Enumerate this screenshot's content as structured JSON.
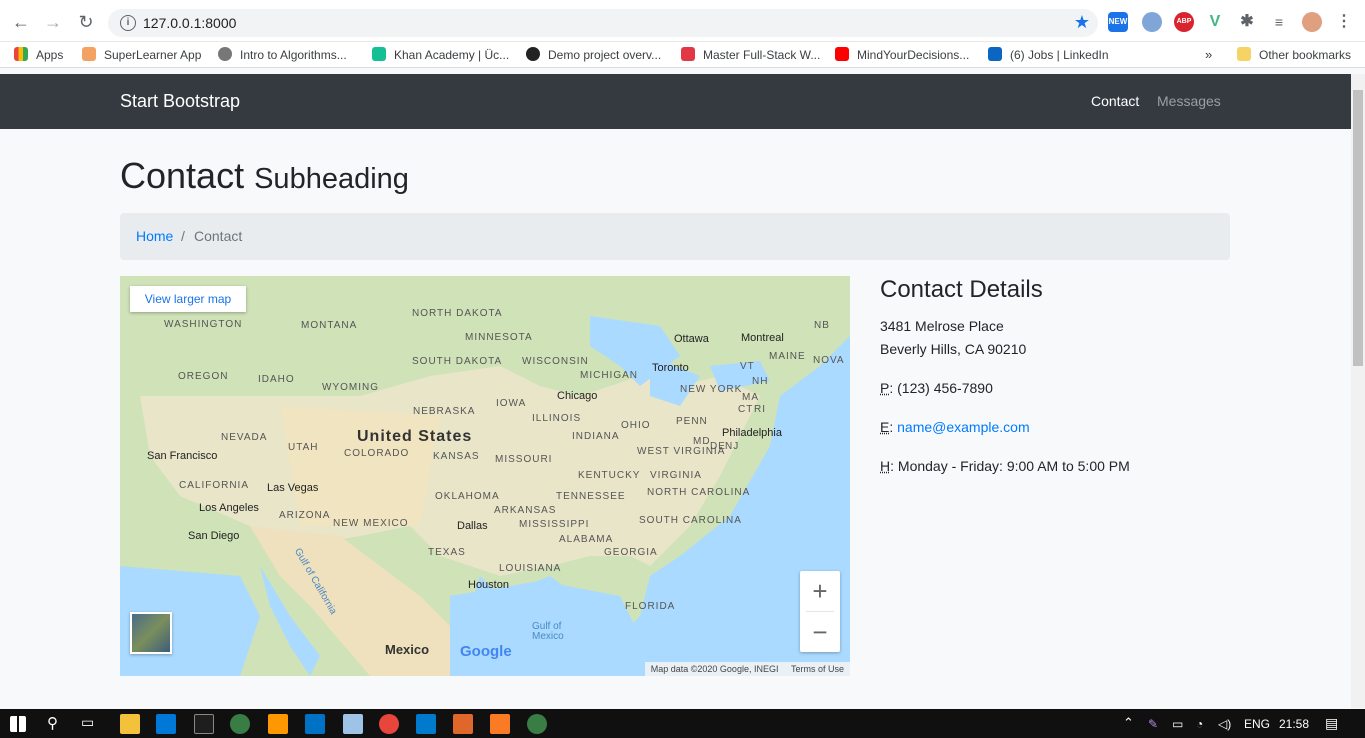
{
  "browser": {
    "url": "127.0.0.1:8000",
    "bookmarks": [
      {
        "label": "Apps",
        "color": "#e8453c"
      },
      {
        "label": "SuperLearner App",
        "color": "#f4a261"
      },
      {
        "label": "Intro to Algorithms...",
        "color": "#666666"
      },
      {
        "label": "Khan Academy | Üc...",
        "color": "#14bf96"
      },
      {
        "label": "Demo project overv...",
        "color": "#222222"
      },
      {
        "label": "Master Full-Stack W...",
        "color": "#e23744"
      },
      {
        "label": "MindYourDecisions...",
        "color": "#ff0000"
      },
      {
        "label": "(6) Jobs | LinkedIn",
        "color": "#0a66c2"
      }
    ],
    "bookmarks_overflow": "»",
    "other_bookmarks": "Other bookmarks"
  },
  "site": {
    "brand": "Start Bootstrap",
    "nav": [
      {
        "label": "Contact",
        "active": true
      },
      {
        "label": "Messages",
        "active": false
      }
    ]
  },
  "page": {
    "title": "Contact",
    "subtitle": "Subheading",
    "breadcrumb": {
      "home": "Home",
      "separator": "/",
      "current": "Contact"
    }
  },
  "map": {
    "view_larger": "View larger map",
    "zoom_in": "+",
    "zoom_out": "−",
    "attribution": "Map data ©2020 Google, INEGI",
    "terms": "Terms of Use",
    "logo": "Google",
    "country_label": "United States",
    "mexico_label": "Mexico",
    "regions": [
      "WASHINGTON",
      "MONTANA",
      "NORTH DAKOTA",
      "MINNESOTA",
      "OREGON",
      "IDAHO",
      "WYOMING",
      "SOUTH DAKOTA",
      "WISCONSIN",
      "MICHIGAN",
      "NEBRASKA",
      "IOWA",
      "ILLINOIS",
      "INDIANA",
      "OHIO",
      "NEVADA",
      "UTAH",
      "COLORADO",
      "KANSAS",
      "MISSOURI",
      "CALIFORNIA",
      "ARIZONA",
      "NEW MEXICO",
      "OKLAHOMA",
      "ARKANSAS",
      "TENNESSEE",
      "KENTUCKY",
      "WEST VIRGINIA",
      "VIRGINIA",
      "NORTH CAROLINA",
      "SOUTH CAROLINA",
      "TEXAS",
      "LOUISIANA",
      "MISSISSIPPI",
      "ALABAMA",
      "GEORGIA",
      "FLORIDA",
      "PENN",
      "NEW YORK",
      "MAINE",
      "NB",
      "NOVA",
      "VT",
      "NH",
      "MA",
      "CT",
      "RI",
      "MD",
      "DE",
      "NJ"
    ],
    "cities": [
      "Ottawa",
      "Montreal",
      "Toronto",
      "Chicago",
      "Philadelphia",
      "San Francisco",
      "Las Vegas",
      "Los Angeles",
      "San Diego",
      "Dallas",
      "Houston"
    ],
    "water": [
      "Gulf of California",
      "Gulf of Mexico"
    ]
  },
  "contact": {
    "heading": "Contact Details",
    "address1": "3481 Melrose Place",
    "address2": "Beverly Hills, CA 90210",
    "phone_abbr": "P",
    "phone": ": (123) 456-7890",
    "email_abbr": "E",
    "email_sep": ": ",
    "email": "name@example.com",
    "hours_abbr": "H",
    "hours": ": Monday - Friday: 9:00 AM to 5:00 PM"
  },
  "taskbar": {
    "language": "ENG",
    "time": "21:58"
  }
}
